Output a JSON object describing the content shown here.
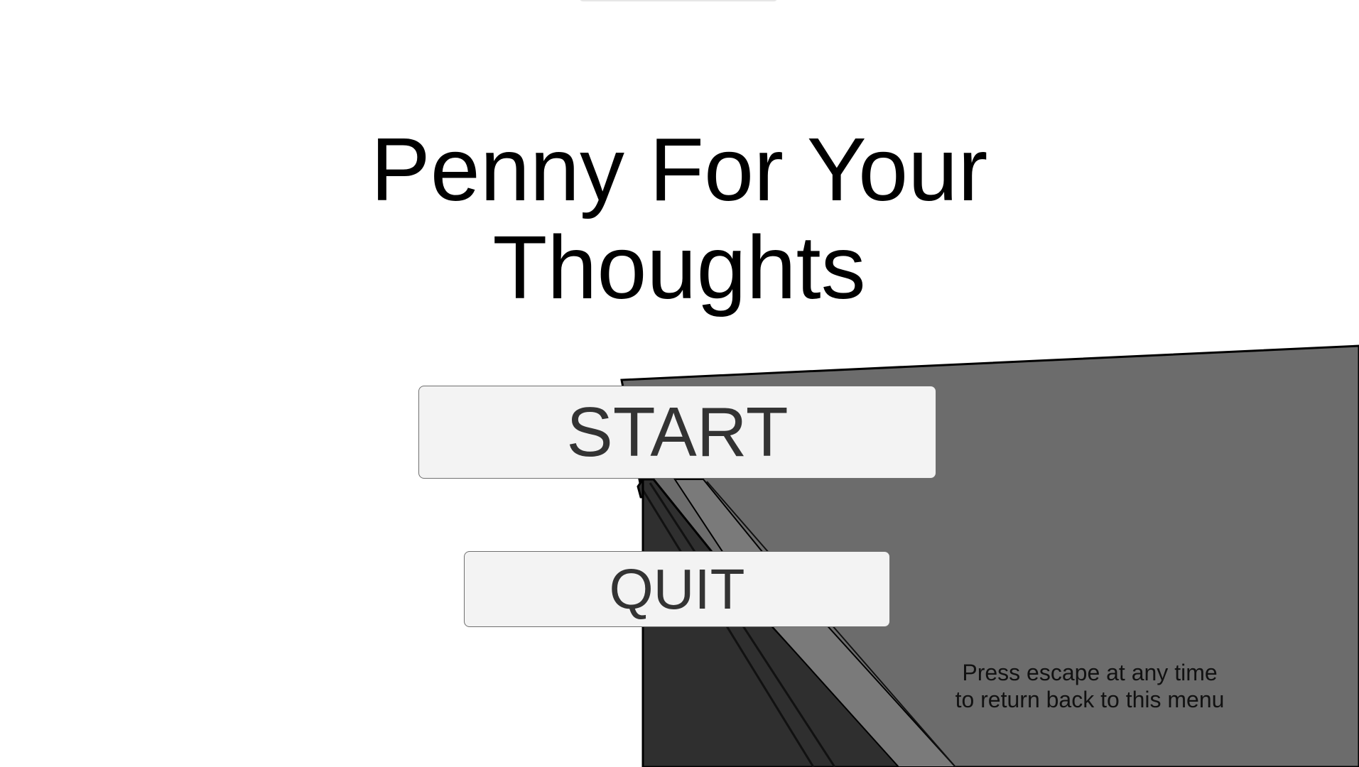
{
  "game": {
    "title_line1": "Penny For Your",
    "title_line2": "Thoughts",
    "start_label": "START",
    "quit_label": "QUIT",
    "hint_line1": "Press escape at any time",
    "hint_line2": "to return back to this menu"
  },
  "colors": {
    "background": "#ffffff",
    "board_face": "#6c6c6c",
    "board_edge_dark": "#333333",
    "board_outline": "#000000",
    "button_fill": "#f3f3f3",
    "button_text": "#333333",
    "title_text": "#000000"
  }
}
